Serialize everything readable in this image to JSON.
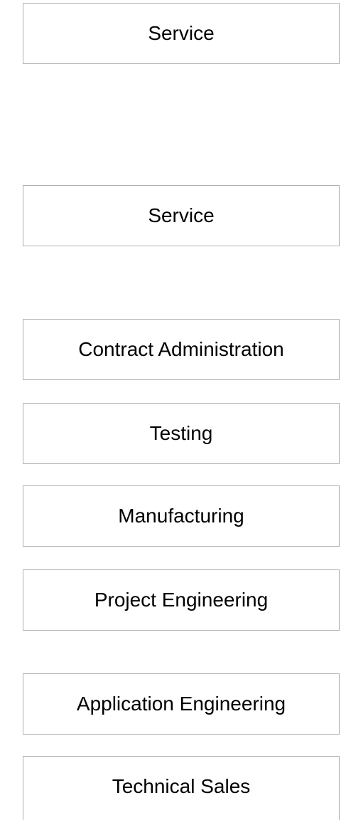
{
  "boxes": [
    {
      "label": "Service"
    },
    {
      "label": "Service"
    },
    {
      "label": "Contract Administration"
    },
    {
      "label": "Testing"
    },
    {
      "label": "Manufacturing"
    },
    {
      "label": "Project Engineering"
    },
    {
      "label": "Application Engineering"
    },
    {
      "label": "Technical Sales"
    }
  ]
}
